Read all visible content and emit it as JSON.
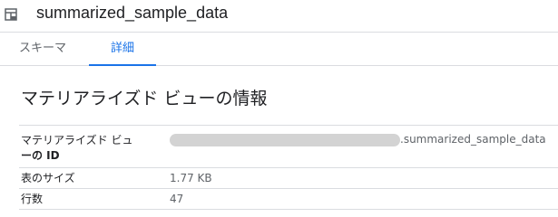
{
  "header": {
    "title": "summarized_sample_data",
    "icon": "materialized-view-icon"
  },
  "tabs": [
    {
      "label": "スキーマ",
      "active": false
    },
    {
      "label": "詳細",
      "active": true
    }
  ],
  "section": {
    "title": "マテリアライズド ビューの情報"
  },
  "properties": {
    "id": {
      "label_line1": "マテリアライズド ビュ",
      "label_line2": "ーの ID",
      "value_suffix": ".summarized_sample_data"
    },
    "size": {
      "label": "表のサイズ",
      "value": "1.77 KB"
    },
    "rows": {
      "label": "行数",
      "value": "47"
    }
  },
  "colors": {
    "accent": "#1a73e8",
    "divider": "#dadce0",
    "text_primary": "#202124",
    "text_secondary": "#5f6368"
  }
}
